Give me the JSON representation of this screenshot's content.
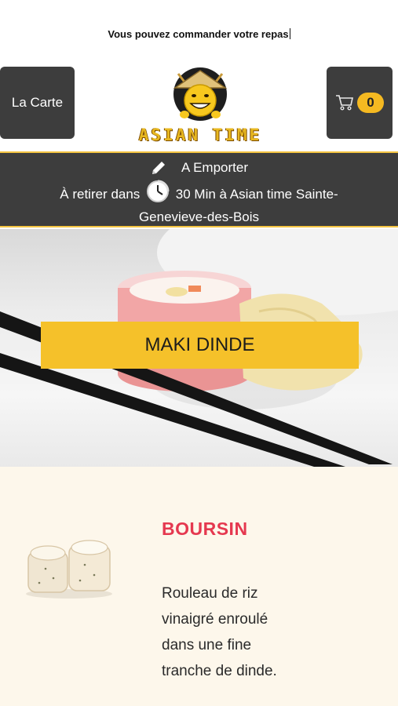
{
  "banner": {
    "message": "Vous pouvez commander votre repas"
  },
  "header": {
    "menu_label": "La Carte",
    "cart_count": "0",
    "logo_text": "ASIAN TIME"
  },
  "order_info": {
    "mode": "A Emporter",
    "line1_prefix": "À retirer dans",
    "line1_suffix": "30 Min à Asian time Sainte-",
    "line2": "Genevieve-des-Bois"
  },
  "hero": {
    "title": "MAKI DINDE"
  },
  "product": {
    "name": "BOURSIN",
    "description": "Rouleau de riz vinaigré enroulé dans une fine tranche de dinde."
  },
  "colors": {
    "accent": "#f5c12a",
    "dark_panel": "#3d3d3d",
    "product_title": "#e5384f",
    "product_bg": "#fdf7eb"
  }
}
